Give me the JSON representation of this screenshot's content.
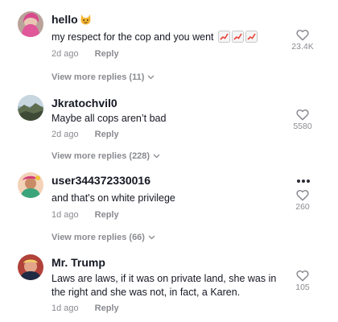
{
  "comments": [
    {
      "username": "hello",
      "text": "my respect for the cop and you went",
      "age": "2d ago",
      "reply_label": "Reply",
      "likes": "23.4K",
      "avatar_icon": "avatar-pink-hair",
      "name_emoji_icon": "cat-emoji-icon",
      "text_emoji_icon": "chart-increasing-emoji-icon"
    },
    {
      "username": "Jkratochvil0",
      "text": "Maybe all cops aren’t bad",
      "age": "2d ago",
      "reply_label": "Reply",
      "likes": "5580",
      "avatar_icon": "avatar-landscape"
    },
    {
      "username": "user344372330016",
      "text": "and that's on white privilege",
      "age": "1d ago",
      "reply_label": "Reply",
      "likes": "260",
      "avatar_icon": "avatar-colorful"
    },
    {
      "username": "Mr. Trump",
      "text": "Laws are laws, if it was on private land, she was in the right and she was not, in fact, a Karen.",
      "age": "1d ago",
      "reply_label": "Reply",
      "likes": "105",
      "avatar_icon": "avatar-portrait"
    }
  ],
  "view_more": [
    "View more replies (11)",
    "View more replies (228)",
    "View more replies (66)"
  ],
  "colors": {
    "primary_text": "#161823",
    "secondary_text": "#8a8b91",
    "chart_emoji_red": "#e8423b"
  }
}
